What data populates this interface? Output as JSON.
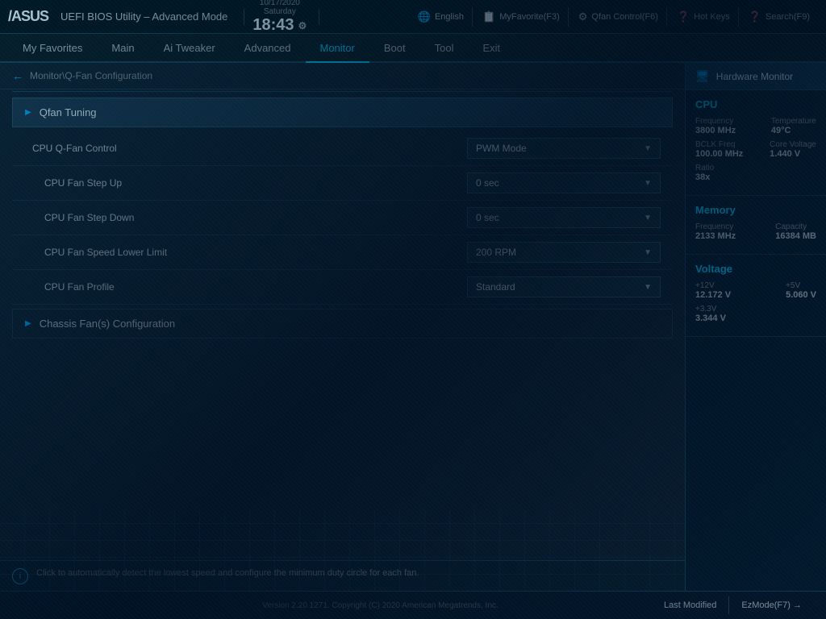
{
  "bios": {
    "logo": "/ASUS",
    "title": "UEFI BIOS Utility – Advanced Mode"
  },
  "header": {
    "date": "10/17/2020",
    "day": "Saturday",
    "time": "18:43",
    "gear_icon": "⚙",
    "nav_items": [
      {
        "label": "English",
        "icon": "🌐",
        "key": "english"
      },
      {
        "label": "MyFavorite(F3)",
        "icon": "📋",
        "key": "myfavorite"
      },
      {
        "label": "Qfan Control(F6)",
        "icon": "🔧",
        "key": "qfan"
      },
      {
        "label": "Hot Keys",
        "icon": "❓",
        "key": "hotkeys"
      },
      {
        "label": "Search(F9)",
        "icon": "❓",
        "key": "search"
      }
    ]
  },
  "menu": {
    "items": [
      {
        "label": "My Favorites",
        "key": "favorites",
        "active": false
      },
      {
        "label": "Main",
        "key": "main",
        "active": false
      },
      {
        "label": "Ai Tweaker",
        "key": "aitweaker",
        "active": false
      },
      {
        "label": "Advanced",
        "key": "advanced",
        "active": false
      },
      {
        "label": "Monitor",
        "key": "monitor",
        "active": true
      },
      {
        "label": "Boot",
        "key": "boot",
        "active": false
      },
      {
        "label": "Tool",
        "key": "tool",
        "active": false
      },
      {
        "label": "Exit",
        "key": "exit",
        "active": false
      }
    ]
  },
  "breadcrumb": {
    "path": "Monitor\\Q-Fan Configuration",
    "arrow": "←"
  },
  "qfan_section": {
    "title": "Qfan Tuning",
    "expand_icon": "▶",
    "settings": [
      {
        "label": "CPU Q-Fan Control",
        "indent": false,
        "value": "PWM Mode",
        "key": "cpu-qfan-control"
      },
      {
        "label": "CPU Fan Step Up",
        "indent": true,
        "value": "0 sec",
        "key": "cpu-fan-step-up"
      },
      {
        "label": "CPU Fan Step Down",
        "indent": true,
        "value": "0 sec",
        "key": "cpu-fan-step-down"
      },
      {
        "label": "CPU Fan Speed Lower Limit",
        "indent": true,
        "value": "200 RPM",
        "key": "cpu-fan-speed-lower"
      },
      {
        "label": "CPU Fan Profile",
        "indent": true,
        "value": "Standard",
        "key": "cpu-fan-profile"
      }
    ]
  },
  "chassis_section": {
    "title": "Chassis Fan(s) Configuration",
    "expand_icon": "▶"
  },
  "info": {
    "icon": "i",
    "text": "Click to automatically detect the lowest speed and configure the minimum duty circle for each fan."
  },
  "hw_monitor": {
    "title": "Hardware Monitor",
    "icon": "🖥",
    "sections": {
      "cpu": {
        "title": "CPU",
        "rows": [
          {
            "label": "Frequency",
            "value": "3800 MHz",
            "key": "cpu-frequency"
          },
          {
            "label": "Temperature",
            "value": "49°C",
            "key": "cpu-temperature"
          },
          {
            "label": "BCLK Freq",
            "value": "100.00 MHz",
            "key": "cpu-bclk"
          },
          {
            "label": "Core Voltage",
            "value": "1.440 V",
            "key": "cpu-voltage"
          },
          {
            "label": "Ratio",
            "value": "38x",
            "key": "cpu-ratio",
            "single": true
          }
        ]
      },
      "memory": {
        "title": "Memory",
        "rows": [
          {
            "label": "Frequency",
            "value": "2133 MHz",
            "key": "mem-frequency"
          },
          {
            "label": "Capacity",
            "value": "16384 MB",
            "key": "mem-capacity"
          }
        ]
      },
      "voltage": {
        "title": "Voltage",
        "rows": [
          {
            "label": "+12V",
            "value": "12.172 V",
            "key": "v12"
          },
          {
            "label": "+5V",
            "value": "5.060 V",
            "key": "v5"
          },
          {
            "label": "+3.3V",
            "value": "3.344 V",
            "key": "v33",
            "single": true
          }
        ]
      }
    }
  },
  "footer": {
    "version": "Version 2.20.1271. Copyright (C) 2020 American Megatrends, Inc.",
    "buttons": [
      {
        "label": "Last Modified",
        "key": "last-modified"
      },
      {
        "label": "EzMode(F7)",
        "key": "ezmode"
      },
      {
        "label": "→",
        "key": "arrow"
      }
    ]
  }
}
